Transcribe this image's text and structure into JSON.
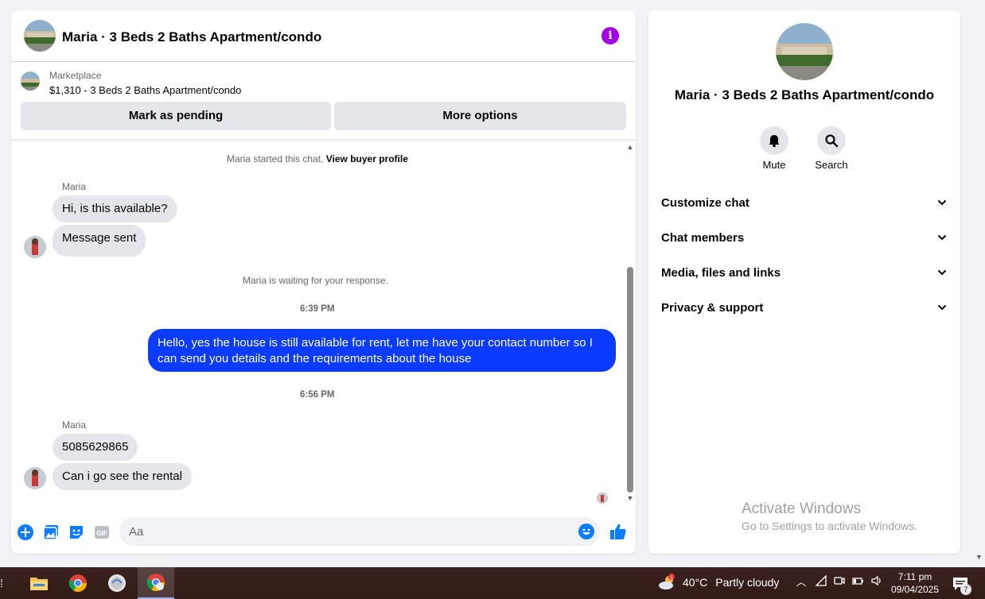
{
  "chat": {
    "title": "Maria · 3 Beds 2 Baths Apartment/condo",
    "marketplace_label": "Marketplace",
    "listing": "$1,310 - 3 Beds 2 Baths Apartment/condo",
    "buttons": {
      "pending": "Mark as pending",
      "options": "More options"
    },
    "started_text": "Maria started this chat.",
    "buyer_profile_link": "View buyer profile",
    "waiting_text": "Maria is waiting for your response.",
    "sender": "Maria",
    "messages_1": [
      "Hi, is this available?",
      "Message sent"
    ],
    "time_1": "6:39 PM",
    "outgoing": "Hello, yes the house is still available for rent, let me have your contact number so I can send you details and the requirements about the house",
    "time_2": "6:56 PM",
    "messages_2": [
      "5085629865",
      "Can i go see the rental"
    ],
    "composer_placeholder": "Aa",
    "accent_color": "#0a3bff"
  },
  "info": {
    "title": "Maria · 3 Beds 2 Baths Apartment/condo",
    "actions": {
      "mute": "Mute",
      "search": "Search"
    },
    "sections": [
      "Customize chat",
      "Chat members",
      "Media, files and links",
      "Privacy & support"
    ]
  },
  "watermark": {
    "line1": "Activate Windows",
    "line2": "Go to Settings to activate Windows."
  },
  "taskbar": {
    "temperature": "40°C",
    "condition": "Partly cloudy",
    "weather_badge": "1",
    "time": "7:11 pm",
    "date": "09/04/2025",
    "notification_count": "7"
  }
}
